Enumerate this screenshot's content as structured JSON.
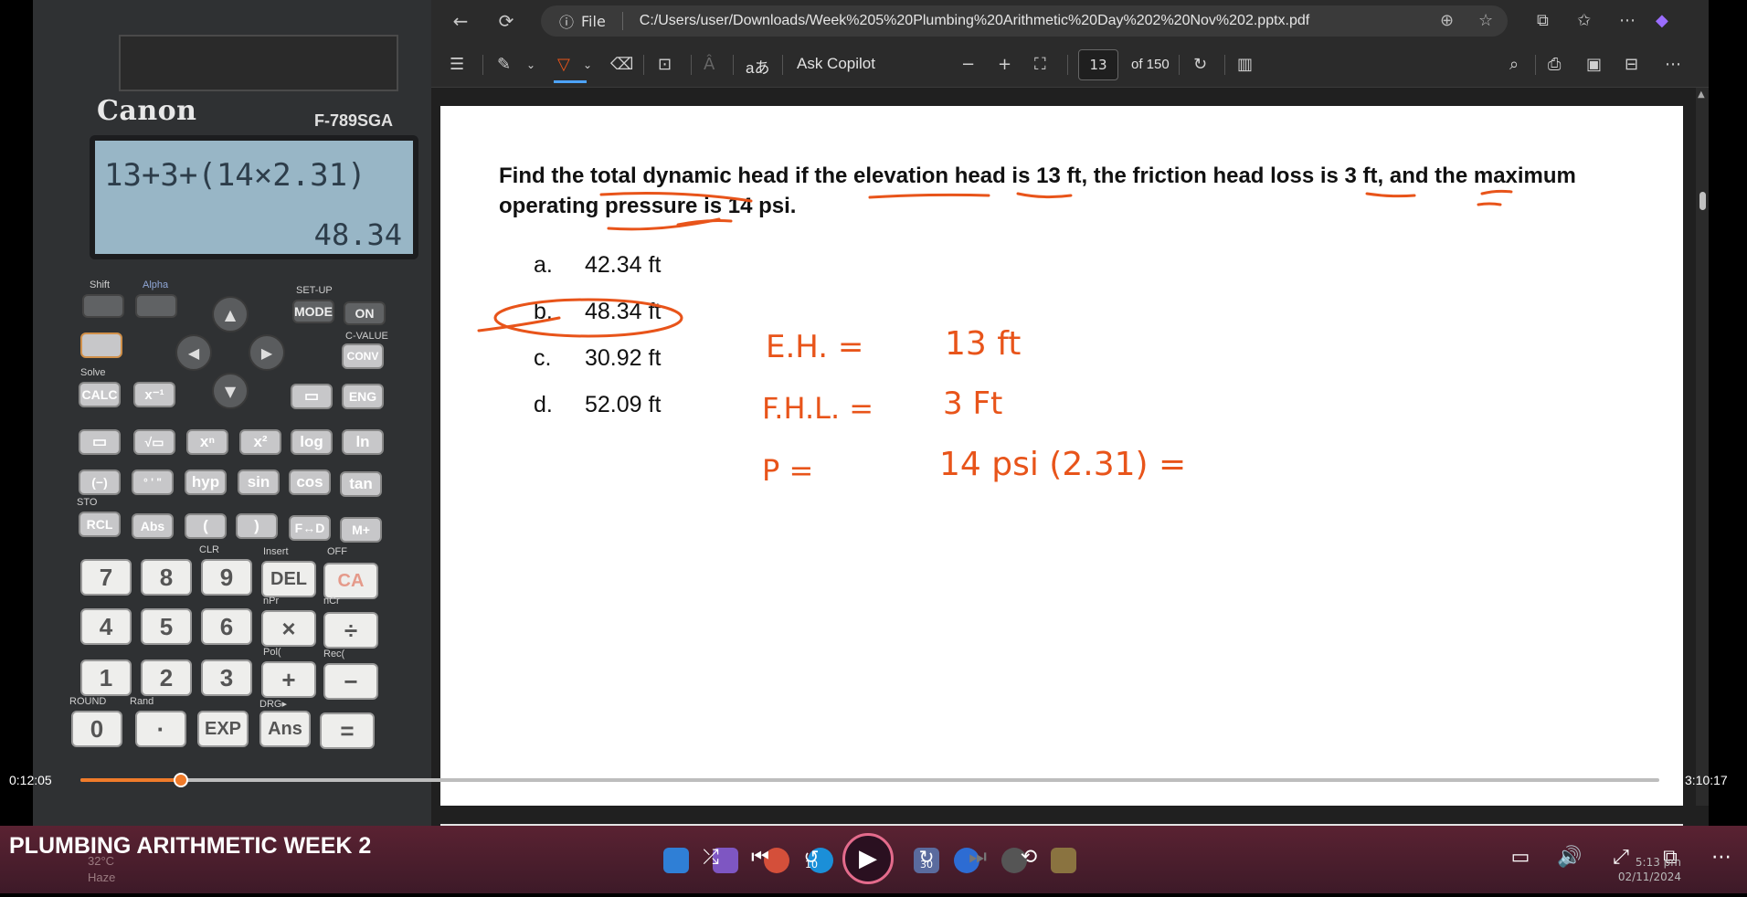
{
  "calculator": {
    "brand": "Canon",
    "model": "F-789SGA",
    "display_input": "13+3+(14×2.31)",
    "display_result": "48.34",
    "keys": {
      "shift": "Shift",
      "alpha": "Alpha",
      "setup": "SET-UP",
      "mode": "MODE",
      "on": "ON",
      "cvalue": "C-VALUE",
      "conv": "CONV",
      "calc": "CALC",
      "inv": "x⁻¹",
      "eng": "ENG",
      "solve": "Solve",
      "frac": "▭",
      "sqrt": "√▭",
      "square": "x²",
      "pow": "xⁿ",
      "log": "log",
      "ln": "ln",
      "neg": "(−)",
      "dms": "° ' \"",
      "hyp": "hyp",
      "sin": "sin",
      "cos": "cos",
      "tan": "tan",
      "rcl": "RCL",
      "abs": "Abs",
      "lparen": "(",
      "rparen": ")",
      "fd": "F↔D",
      "mplus": "M+",
      "n7": "7",
      "n8": "8",
      "n9": "9",
      "del": "DEL",
      "ca": "CA",
      "n4": "4",
      "n5": "5",
      "n6": "6",
      "mul": "×",
      "div": "÷",
      "n1": "1",
      "n2": "2",
      "n3": "3",
      "plus": "+",
      "minus": "−",
      "n0": "0",
      "dot": "·",
      "exp": "EXP",
      "ans": "Ans",
      "eq": "=",
      "clr": "CLR",
      "insert": "Insert",
      "off": "OFF",
      "npr": "nPr",
      "ncr": "nCr",
      "pol": "Pol(",
      "rec": "Rec(",
      "round": "ROUND",
      "rand": "Rand",
      "sto": "STO",
      "drg": "DRG▸"
    }
  },
  "browser": {
    "url_scheme": "File",
    "url": "C:/Users/user/Downloads/Week%205%20Plumbing%20Arithmetic%20Day%202%20Nov%202.pptx.pdf",
    "ask_copilot": "Ask Copilot",
    "page_current": "13",
    "page_total": "of 150",
    "ai_text_label": "aあ",
    "read_aloud_label": "Â"
  },
  "pdf": {
    "question": "Find the total dynamic head if the elevation head is 13 ft, the friction head loss is 3 ft, and the maximum operating pressure is 14 psi.",
    "options": [
      {
        "letter": "a.",
        "text": "42.34 ft"
      },
      {
        "letter": "b.",
        "text": "48.34 ft"
      },
      {
        "letter": "c.",
        "text": "30.92 ft"
      },
      {
        "letter": "d.",
        "text": "52.09 ft"
      }
    ],
    "handwriting": [
      {
        "label": "E.H. =",
        "value": "13 ft"
      },
      {
        "label": "F.H.L. =",
        "value": "3 Ft"
      },
      {
        "label": "P =",
        "value": "14 psi (2.31) ="
      }
    ],
    "ink_color": "#e8541a"
  },
  "player": {
    "current_time": "0:12:05",
    "total_time": "3:10:17",
    "progress": 0.0635,
    "title": "PLUMBING ARITHMETIC WEEK 2",
    "skip_back": "10",
    "skip_forward": "30",
    "accent": "#f07b2a"
  },
  "system": {
    "temperature": "32°C",
    "weather": "Haze",
    "time": "5:13 pm",
    "date": "02/11/2024"
  }
}
